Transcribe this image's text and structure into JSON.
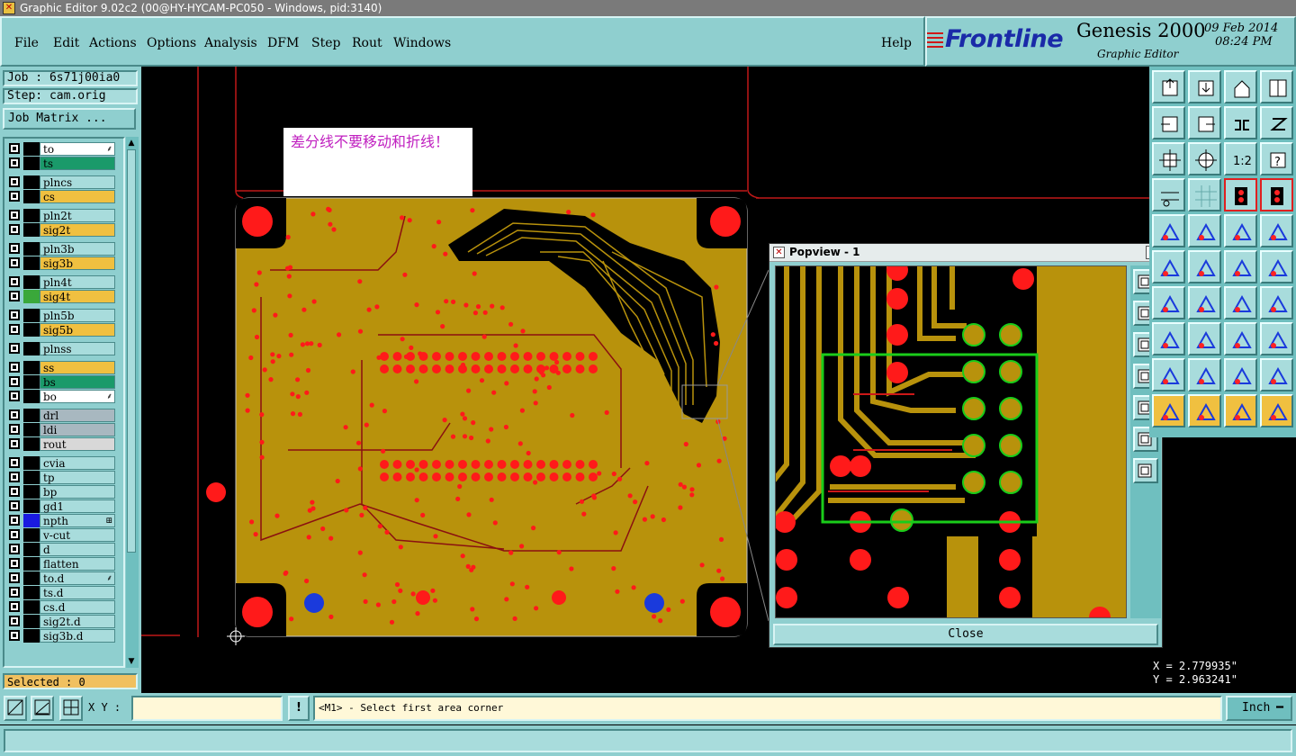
{
  "window": {
    "title": "Graphic Editor 9.02c2 (00@HY-HYCAM-PC050 - Windows, pid:3140)"
  },
  "menu": [
    "File",
    "Edit",
    "Actions",
    "Options",
    "Analysis",
    "DFM",
    "Step",
    "Rout",
    "Windows"
  ],
  "help": "Help",
  "brand": {
    "logo": "Frontline",
    "product": "Genesis 2000",
    "subtitle": "Graphic Editor",
    "date": "09 Feb 2014",
    "time": "08:24 PM"
  },
  "job": {
    "job_label": "Job : 6s71j00ia0",
    "step_label": "Step: cam.orig",
    "matrix_button": "Job Matrix ..."
  },
  "layers": [
    {
      "name": "to",
      "color": "#ffffff",
      "sw": "#000000",
      "mark": "⸙"
    },
    {
      "name": "ts",
      "color": "#1a9a6a",
      "sw": "#000000",
      "mark": ""
    },
    {
      "name": "plncs",
      "color": "#a8dcdc",
      "sw": "#000000",
      "mark": ""
    },
    {
      "name": "cs",
      "color": "#f0c040",
      "sw": "#000000",
      "mark": ""
    },
    {
      "name": "pln2t",
      "color": "#a8dcdc",
      "sw": "#000000",
      "mark": ""
    },
    {
      "name": "sig2t",
      "color": "#f0c040",
      "sw": "#000000",
      "mark": ""
    },
    {
      "name": "pln3b",
      "color": "#a8dcdc",
      "sw": "#000000",
      "mark": ""
    },
    {
      "name": "sig3b",
      "color": "#f0c040",
      "sw": "#000000",
      "mark": ""
    },
    {
      "name": "pln4t",
      "color": "#a8dcdc",
      "sw": "#000000",
      "mark": ""
    },
    {
      "name": "sig4t",
      "color": "#f0c040",
      "sw": "#3aa83a",
      "mark": ""
    },
    {
      "name": "pln5b",
      "color": "#a8dcdc",
      "sw": "#000000",
      "mark": ""
    },
    {
      "name": "sig5b",
      "color": "#f0c040",
      "sw": "#000000",
      "mark": ""
    },
    {
      "name": "plnss",
      "color": "#a8dcdc",
      "sw": "#000000",
      "mark": ""
    },
    {
      "name": "ss",
      "color": "#f0c040",
      "sw": "#000000",
      "mark": ""
    },
    {
      "name": "bs",
      "color": "#1a9a6a",
      "sw": "#000000",
      "mark": ""
    },
    {
      "name": "bo",
      "color": "#ffffff",
      "sw": "#000000",
      "mark": "⸙"
    },
    {
      "name": "drl",
      "color": "#a8b8c0",
      "sw": "#000000",
      "mark": ""
    },
    {
      "name": "ldi",
      "color": "#a8b8c0",
      "sw": "#000000",
      "mark": ""
    },
    {
      "name": "rout",
      "color": "#d8d8d8",
      "sw": "#000000",
      "mark": ""
    },
    {
      "name": "cvia",
      "color": "#a8dcdc",
      "sw": "#000000",
      "mark": ""
    },
    {
      "name": "tp",
      "color": "#a8dcdc",
      "sw": "#000000",
      "mark": ""
    },
    {
      "name": "bp",
      "color": "#a8dcdc",
      "sw": "#000000",
      "mark": ""
    },
    {
      "name": "gd1",
      "color": "#a8dcdc",
      "sw": "#000000",
      "mark": ""
    },
    {
      "name": "npth",
      "color": "#a8dcdc",
      "sw": "#1a1ae0",
      "mark": "⊞"
    },
    {
      "name": "v-cut",
      "color": "#a8dcdc",
      "sw": "#000000",
      "mark": ""
    },
    {
      "name": "d",
      "color": "#a8dcdc",
      "sw": "#000000",
      "mark": ""
    },
    {
      "name": "flatten",
      "color": "#a8dcdc",
      "sw": "#000000",
      "mark": ""
    },
    {
      "name": "to.d",
      "color": "#a8dcdc",
      "sw": "#000000",
      "mark": "⸙"
    },
    {
      "name": "ts.d",
      "color": "#a8dcdc",
      "sw": "#000000",
      "mark": ""
    },
    {
      "name": "cs.d",
      "color": "#a8dcdc",
      "sw": "#000000",
      "mark": ""
    },
    {
      "name": "sig2t.d",
      "color": "#a8dcdc",
      "sw": "#000000",
      "mark": ""
    },
    {
      "name": "sig3b.d",
      "color": "#a8dcdc",
      "sw": "#000000",
      "mark": ""
    }
  ],
  "selected": "Selected : 0",
  "note": "差分线不要移动和折线！",
  "popview": {
    "title": "Popview - 1",
    "close": "Close"
  },
  "coords": {
    "x": "X = 2.779935\"",
    "y": "Y = 2.963241\""
  },
  "bottom": {
    "xy_label": "X Y :",
    "xy_value": "",
    "bang": "!",
    "prompt": "<M1> - Select first area corner",
    "units": "Inch"
  },
  "colors": {
    "copper": "#b8920c",
    "pad": "#ff1a1a",
    "highlight": "#1acc1a",
    "ui_teal": "#8fcfcf"
  }
}
